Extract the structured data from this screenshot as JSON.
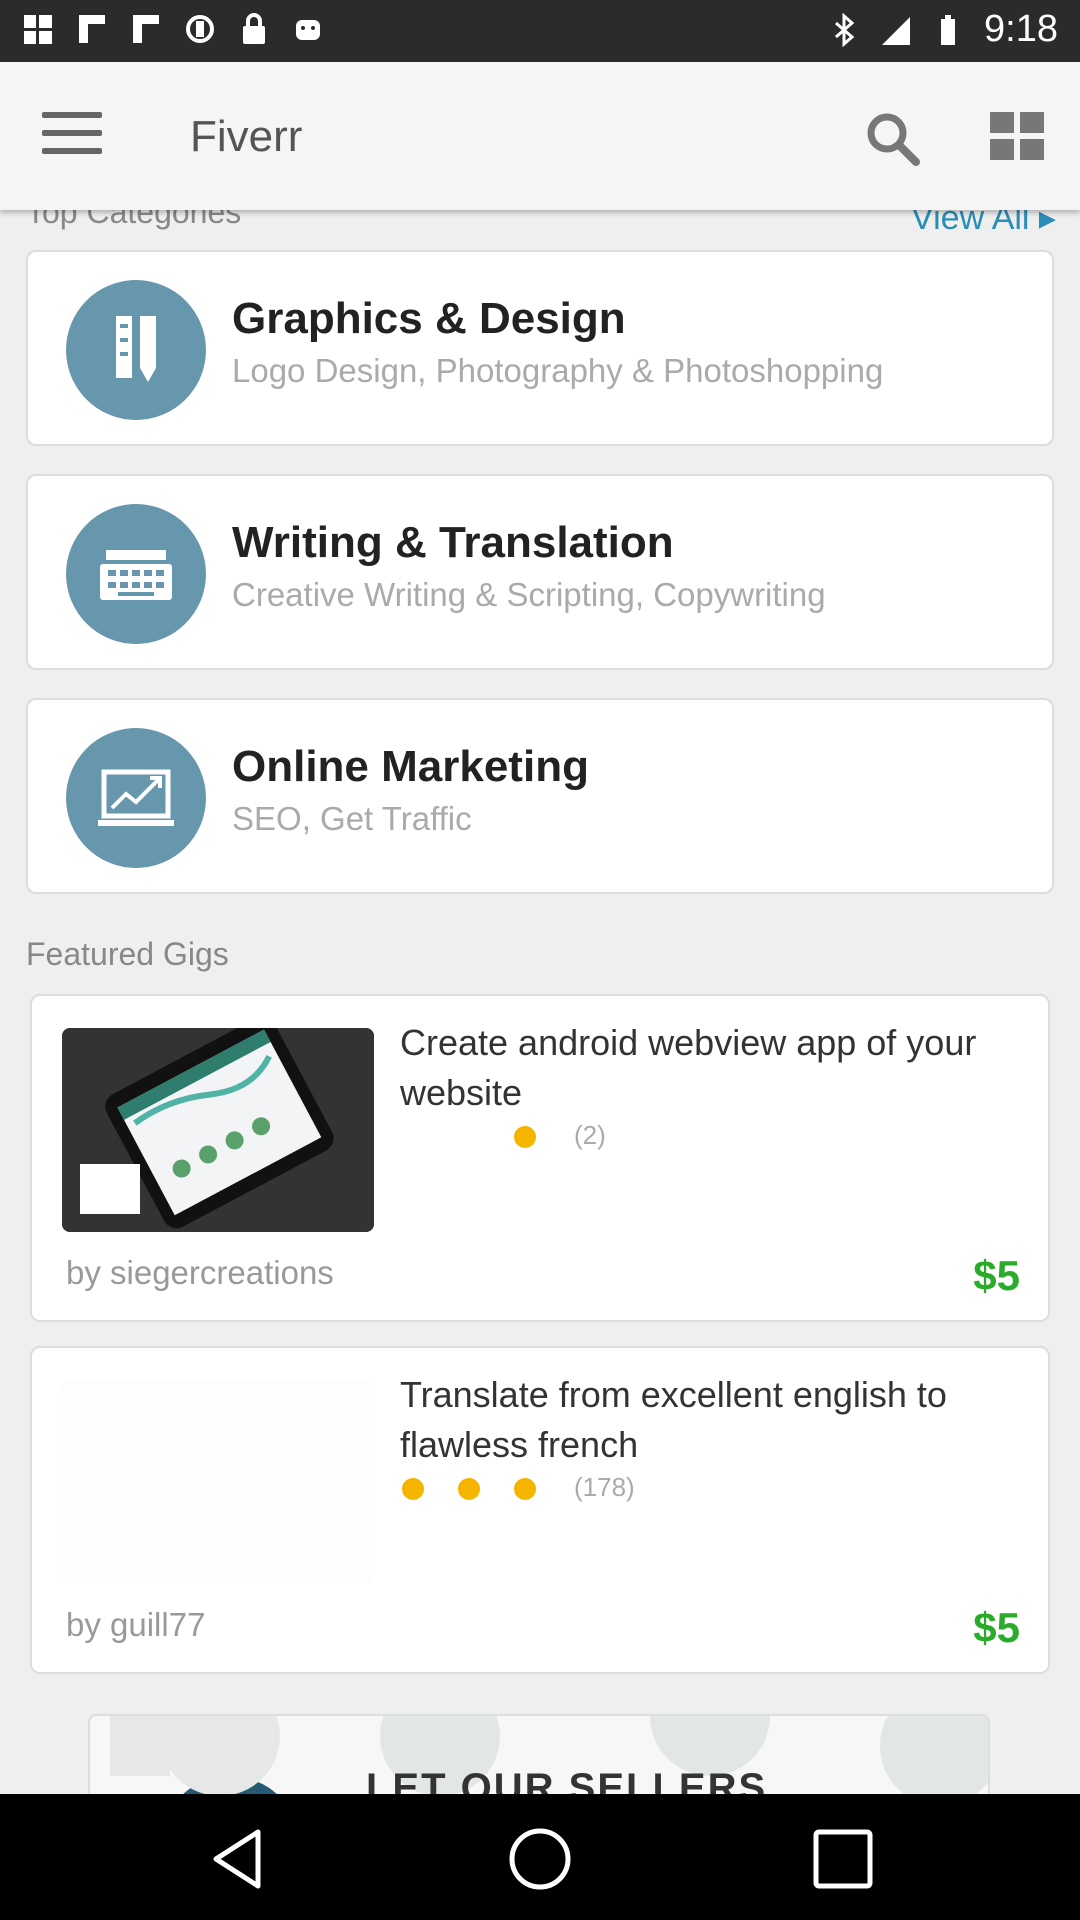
{
  "status_bar": {
    "time": "9:18",
    "icons": [
      "windows-icon",
      "flipboard-icon",
      "flipboard-icon",
      "sync-icon",
      "lock-icon",
      "android-icon",
      "bluetooth-icon",
      "signal-icon",
      "battery-icon"
    ]
  },
  "app_bar": {
    "title": "Fiverr",
    "icons": [
      "menu-icon",
      "search-icon",
      "grid-icon"
    ]
  },
  "top_categories": {
    "heading": "Top Categories",
    "view_all": "View All ▸",
    "items": [
      {
        "name": "Graphics & Design",
        "subtitle": "Logo Design, Photography & Photoshopping",
        "icon": "pencil-ruler-icon"
      },
      {
        "name": "Writing & Translation",
        "subtitle": "Creative Writing & Scripting, Copywriting",
        "icon": "typewriter-icon"
      },
      {
        "name": "Online Marketing",
        "subtitle": "SEO, Get Traffic",
        "icon": "chart-monitor-icon"
      }
    ]
  },
  "featured_gigs": {
    "heading": "Featured Gigs",
    "items": [
      {
        "title": "Create android webview app of your website",
        "rating_count": "(2)",
        "rating": 1,
        "seller": "by siegercreations",
        "price": "$5",
        "thumb": "android-phone-image"
      },
      {
        "title": "Translate from excellent english to flawless french",
        "rating_count": "(178)",
        "rating": 3,
        "seller": "by guill77",
        "price": "$5",
        "thumb": "blank-image"
      }
    ]
  },
  "banner": {
    "text": "LET OUR SELLERS"
  },
  "nav_bar": {
    "icons": [
      "back-icon",
      "home-icon",
      "recents-icon"
    ]
  },
  "colors": {
    "accent_blue": "#2a8db5",
    "category_circle": "#6797ac",
    "price_green": "#2aab2a",
    "star": "#f4b400"
  }
}
